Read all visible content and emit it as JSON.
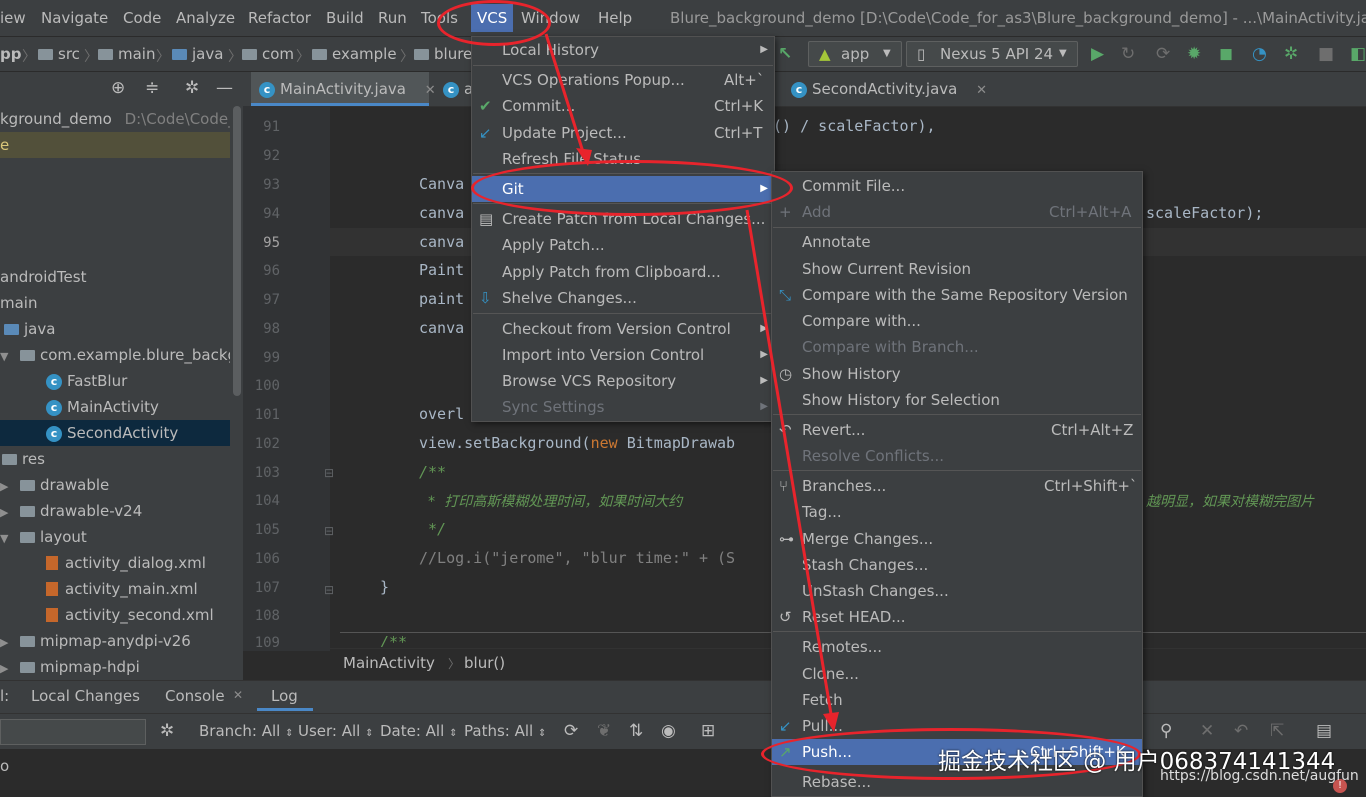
{
  "menubar": {
    "items": [
      "iew",
      "Navigate",
      "Code",
      "Analyze",
      "Refactor",
      "Build",
      "Run",
      "Tools",
      "VCS",
      "Window",
      "Help"
    ],
    "window_title": "Blure_background_demo [D:\\Code\\Code_for_as3\\Blure_background_demo] - ...\\MainActivity.java"
  },
  "navbar": {
    "crumbs": [
      "pp",
      "src",
      "main",
      "java",
      "com",
      "example",
      "blure"
    ],
    "run_config": "app",
    "device": "Nexus 5 API 24"
  },
  "project": {
    "root_label": "kground_demo",
    "root_path": "D:\\Code\\Code_f",
    "yellow_row": "e",
    "rows": [
      {
        "label": "androidTest"
      },
      {
        "label": "main"
      },
      {
        "label": "java"
      },
      {
        "label": "com.example.blure_backgr"
      },
      {
        "label": "FastBlur"
      },
      {
        "label": "MainActivity"
      },
      {
        "label": "SecondActivity"
      },
      {
        "label": "res"
      },
      {
        "label": "drawable"
      },
      {
        "label": "drawable-v24"
      },
      {
        "label": "layout"
      },
      {
        "label": "activity_dialog.xml"
      },
      {
        "label": "activity_main.xml"
      },
      {
        "label": "activity_second.xml"
      },
      {
        "label": "mipmap-anydpi-v26"
      },
      {
        "label": "mipmap-hdpi"
      }
    ]
  },
  "editor": {
    "tabs": [
      "MainActivity.java",
      "a",
      "SecondActivity.java"
    ],
    "line_numbers": [
      "91",
      "92",
      "93",
      "94",
      "95",
      "96",
      "97",
      "98",
      "99",
      "100",
      "101",
      "102",
      "103",
      "104",
      "105",
      "106",
      "107",
      "108",
      "109"
    ],
    "code": {
      "l91": "t() / scaleFactor),",
      "l93": "Canva",
      "l94a": "canva",
      "l94b": "scaleFactor);",
      "l95": "canva",
      "l96": "Paint",
      "l97": "paint",
      "l98": "canva",
      "l101": "overl",
      "l102a": "view.setBackground(",
      "l102kw": "new",
      "l102b": " BitmapDrawab",
      "l103": "/**",
      "l104a": " * 打印高斯模糊处理时间，如果时间大约",
      "l104b": "越明显，如果对模糊完图片",
      "l105": " */",
      "l106": "//Log.i(\"jerome\", \"blur time:\" + (S",
      "l107": "}",
      "l109": "/**"
    },
    "breadcrumb": [
      "MainActivity",
      "blur()"
    ]
  },
  "bottom": {
    "tabs": [
      "l:",
      "Local Changes",
      "Console",
      "Log"
    ],
    "filters": [
      "Branch: All",
      "User: All",
      "Date: All",
      "Paths: All"
    ],
    "log_row": "o"
  },
  "vcs_menu": {
    "items": [
      {
        "label": "Local History",
        "submenu": true
      },
      {
        "label": "VCS Operations Popup...",
        "shortcut": "Alt+`"
      },
      {
        "label": "Commit...",
        "shortcut": "Ctrl+K"
      },
      {
        "label": "Update Project...",
        "shortcut": "Ctrl+T"
      },
      {
        "label": "Refresh File Status"
      },
      {
        "label": "Git",
        "submenu": true
      },
      {
        "label": "Create Patch from Local Changes..."
      },
      {
        "label": "Apply Patch..."
      },
      {
        "label": "Apply Patch from Clipboard..."
      },
      {
        "label": "Shelve Changes..."
      },
      {
        "label": "Checkout from Version Control",
        "submenu": true
      },
      {
        "label": "Import into Version Control",
        "submenu": true
      },
      {
        "label": "Browse VCS Repository",
        "submenu": true
      },
      {
        "label": "Sync Settings",
        "submenu": true
      }
    ]
  },
  "git_menu": {
    "items": [
      {
        "label": "Commit File..."
      },
      {
        "label": "Add",
        "shortcut": "Ctrl+Alt+A"
      },
      {
        "label": "Annotate"
      },
      {
        "label": "Show Current Revision"
      },
      {
        "label": "Compare with the Same Repository Version"
      },
      {
        "label": "Compare with..."
      },
      {
        "label": "Compare with Branch..."
      },
      {
        "label": "Show History"
      },
      {
        "label": "Show History for Selection"
      },
      {
        "label": "Revert...",
        "shortcut": "Ctrl+Alt+Z"
      },
      {
        "label": "Resolve Conflicts..."
      },
      {
        "label": "Branches...",
        "shortcut": "Ctrl+Shift+`"
      },
      {
        "label": "Tag..."
      },
      {
        "label": "Merge Changes..."
      },
      {
        "label": "Stash Changes..."
      },
      {
        "label": "UnStash Changes..."
      },
      {
        "label": "Reset HEAD..."
      },
      {
        "label": "Remotes..."
      },
      {
        "label": "Clone..."
      },
      {
        "label": "Fetch"
      },
      {
        "label": "Pull..."
      },
      {
        "label": "Push...",
        "shortcut": "Ctrl+Shift+K"
      },
      {
        "label": "Rebase..."
      }
    ]
  },
  "watermark": {
    "text": "掘金技术社区 @ 用户068374141344",
    "url": "https://blog.csdn.net/augfun"
  },
  "colors": {
    "accent": "#4b6eaf",
    "annotation": "#e8242c",
    "class_icon": "#3592c4"
  }
}
